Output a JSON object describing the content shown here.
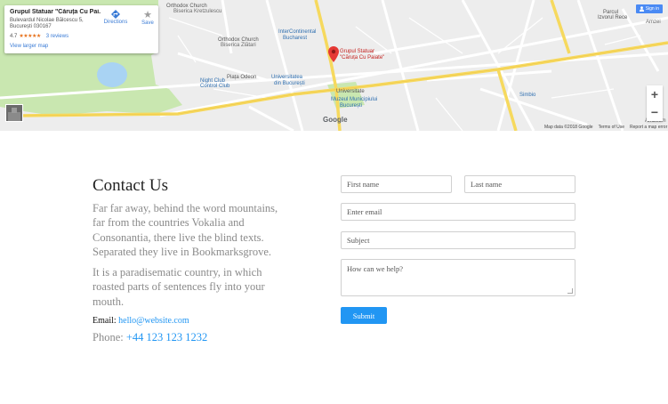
{
  "map": {
    "info_card": {
      "title": "Grupul Statuar \"Căruța Cu Pai...",
      "address_line1": "Bulevardul Nicolae Bălcescu 5,",
      "address_line2": "București 030167",
      "rating": "4.7",
      "stars": "★★★★★",
      "reviews": "3 reviews",
      "larger_map": "View larger map",
      "directions": "Directions",
      "save": "Save"
    },
    "sign_in": "Sign in",
    "labels": {
      "church": "Orthodox Church",
      "biserica": "Biserica Kretzulescu",
      "orthodox2": "Orthodox Church",
      "biserica2": "Biserica Zlătari",
      "intercontinental": "InterContinental",
      "bucharest": "Bucharest",
      "piata_odeon": "Piața Odeon",
      "universitatea": "Universitatea",
      "din_bucuresti": "din București",
      "night_club": "Night Club",
      "control_club": "Control Club",
      "pin_label1": "Grupul Statuar",
      "pin_label2": "\"Căruța Cu Paiate\"",
      "universitate": "Universitate",
      "muzeul1": "Muzeul Municipiului",
      "muzeul2": "București",
      "simbio": "Simbio",
      "parcul1": "Parcul",
      "parcul2": "Izvorul Rece",
      "amzei": "Amzei",
      "ambient": "Amzeum"
    },
    "zoom_in": "+",
    "zoom_out": "−",
    "google_logo": "Google",
    "footer": {
      "map_data": "Map data ©2018 Google",
      "terms": "Terms of Use",
      "report": "Report a map error"
    }
  },
  "contact": {
    "heading": "Contact Us",
    "paragraph1": "Far far away, behind the word mountains, far from the countries Vokalia and Consonantia, there live the blind texts. Separated they live in Bookmarksgrove.",
    "paragraph2": "It is a paradisematic country, in which roasted parts of sentences fly into your mouth.",
    "email_label": "Email:",
    "email_value": "hello@website.com",
    "phone_label": "Phone:",
    "phone_value": "+44 123 123 1232"
  },
  "form": {
    "first_name_placeholder": "First name",
    "last_name_placeholder": "Last name",
    "email_placeholder": "Enter email",
    "subject_placeholder": "Subject",
    "message_placeholder": "How can we help?",
    "submit_label": "Submit"
  },
  "colors": {
    "accent": "#2196f3",
    "map_green": "#c8e6b0",
    "map_water": "#a9d3f3",
    "road_yellow": "#f8df75"
  }
}
